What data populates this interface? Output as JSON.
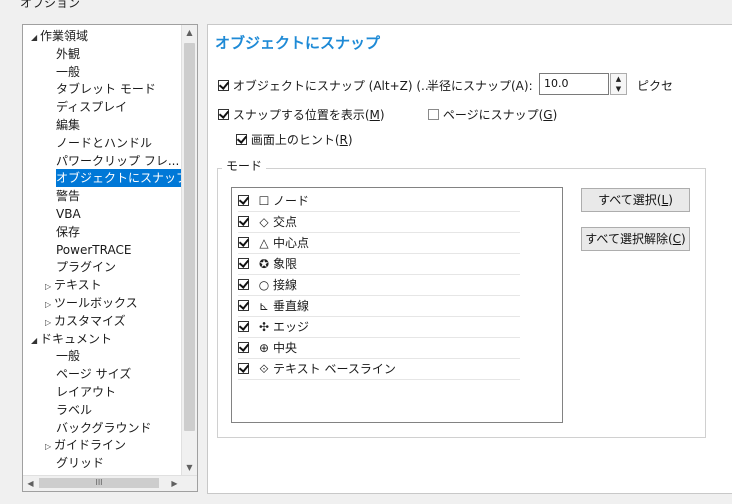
{
  "window": {
    "title": "オプション"
  },
  "tree": {
    "items": [
      {
        "label": "作業領域",
        "arrow": "◢",
        "indent": 0
      },
      {
        "label": "外観",
        "arrow": "",
        "indent": 2
      },
      {
        "label": "一般",
        "arrow": "",
        "indent": 2
      },
      {
        "label": "タブレット モード",
        "arrow": "",
        "indent": 2
      },
      {
        "label": "ディスプレイ",
        "arrow": "",
        "indent": 2
      },
      {
        "label": "編集",
        "arrow": "",
        "indent": 2
      },
      {
        "label": "ノードとハンドル",
        "arrow": "",
        "indent": 2
      },
      {
        "label": "パワークリップ フレ...",
        "arrow": "",
        "indent": 2
      },
      {
        "label": "オブジェクトにスナップ",
        "arrow": "",
        "indent": 2,
        "selected": true
      },
      {
        "label": "警告",
        "arrow": "",
        "indent": 2
      },
      {
        "label": "VBA",
        "arrow": "",
        "indent": 2
      },
      {
        "label": "保存",
        "arrow": "",
        "indent": 2
      },
      {
        "label": "PowerTRACE",
        "arrow": "",
        "indent": 2
      },
      {
        "label": "プラグイン",
        "arrow": "",
        "indent": 2
      },
      {
        "label": "テキスト",
        "arrow": "▷",
        "indent": 1
      },
      {
        "label": "ツールボックス",
        "arrow": "▷",
        "indent": 1
      },
      {
        "label": "カスタマイズ",
        "arrow": "▷",
        "indent": 1
      },
      {
        "label": "ドキュメント",
        "arrow": "◢",
        "indent": 0
      },
      {
        "label": "一般",
        "arrow": "",
        "indent": 2
      },
      {
        "label": "ページ サイズ",
        "arrow": "",
        "indent": 2
      },
      {
        "label": "レイアウト",
        "arrow": "",
        "indent": 2
      },
      {
        "label": "ラベル",
        "arrow": "",
        "indent": 2
      },
      {
        "label": "バックグラウンド",
        "arrow": "",
        "indent": 2
      },
      {
        "label": "ガイドライン",
        "arrow": "▷",
        "indent": 1
      },
      {
        "label": "グリッド",
        "arrow": "",
        "indent": 2
      }
    ],
    "hscroll_thumb": "III"
  },
  "panel": {
    "heading": "オブジェクトにスナップ",
    "snap_checkbox": {
      "label": "オブジェクトにスナップ (Alt+Z) (",
      "label_rest": "...",
      "checked": true
    },
    "radius_label": "半径にスナップ(A):",
    "radius_value": "10.0",
    "radius_unit": "ピクセ",
    "show_position": {
      "label": "スナップする位置を表示(",
      "key": "M",
      "checked": true
    },
    "snap_page": {
      "label": "ページにスナップ(",
      "key": "G",
      "checked": false
    },
    "screen_hints": {
      "label": "画面上のヒント(",
      "key": "R",
      "checked": true
    },
    "mode_group_label": "モード",
    "modes": [
      {
        "symbol": "☐",
        "label": "ノード",
        "checked": true
      },
      {
        "symbol": "◇",
        "label": "交点",
        "checked": true
      },
      {
        "symbol": "△",
        "label": "中心点",
        "checked": true
      },
      {
        "symbol": "✪",
        "label": "象限",
        "checked": true
      },
      {
        "symbol": "○",
        "label": "接線",
        "checked": true
      },
      {
        "symbol": "⊾",
        "label": "垂直線",
        "checked": true
      },
      {
        "symbol": "✣",
        "label": "エッジ",
        "checked": true
      },
      {
        "symbol": "⊕",
        "label": "中央",
        "checked": true
      },
      {
        "symbol": "⟐",
        "label": "テキスト ベースライン",
        "checked": true
      }
    ],
    "select_all": {
      "label": "すべて選択(",
      "key": "L"
    },
    "deselect_all": {
      "label": "すべて選択解除(",
      "key": "C"
    }
  }
}
